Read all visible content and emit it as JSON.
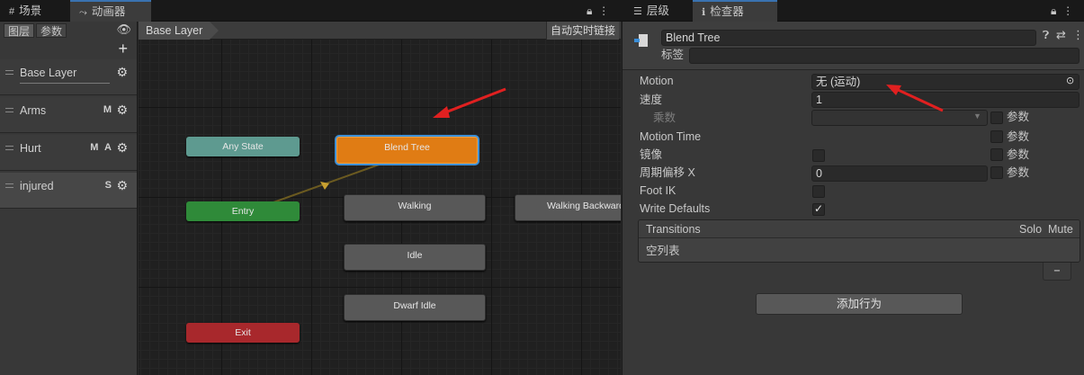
{
  "tabs": {
    "scene": "场景",
    "animator": "动画器",
    "hierarchy": "层级",
    "inspector": "检查器"
  },
  "layers_panel": {
    "tab_layers": "图层",
    "tab_params": "参数",
    "layers": [
      {
        "name": "Base Layer",
        "flags": ""
      },
      {
        "name": "Arms",
        "flags": "M"
      },
      {
        "name": "Hurt",
        "flags": "M A"
      },
      {
        "name": "injured",
        "flags": "S"
      }
    ]
  },
  "graph": {
    "breadcrumb": "Base Layer",
    "auto_live_link": "自动实时链接",
    "nodes": {
      "any_state": "Any State",
      "blend_tree": "Blend Tree",
      "entry": "Entry",
      "walking": "Walking",
      "walking_backward": "Walking Backward",
      "idle": "Idle",
      "dwarf_idle": "Dwarf Idle",
      "exit": "Exit"
    }
  },
  "inspector": {
    "object_name": "Blend Tree",
    "tag_label": "标签",
    "motion_label": "Motion",
    "motion_value": "无 (运动)",
    "speed_label": "速度",
    "speed_value": "1",
    "multiplier_label": "乘数",
    "param_label": "参数",
    "motion_time_label": "Motion Time",
    "mirror_label": "镜像",
    "cycle_offset_label": "周期偏移 X",
    "cycle_offset_value": "0",
    "foot_ik_label": "Foot IK",
    "write_defaults_label": "Write Defaults",
    "write_defaults_checked": true,
    "transitions_title": "Transitions",
    "solo_label": "Solo",
    "mute_label": "Mute",
    "empty_list": "空列表",
    "remove_button": "−",
    "add_behaviour": "添加行为"
  },
  "colors": {
    "any_state": "#5e9a90",
    "entry": "#2f8a39",
    "exit": "#a8282c",
    "blend_tree": "#e07c14",
    "selection": "#3d8fd6",
    "annotation_arrow": "#e02020"
  }
}
